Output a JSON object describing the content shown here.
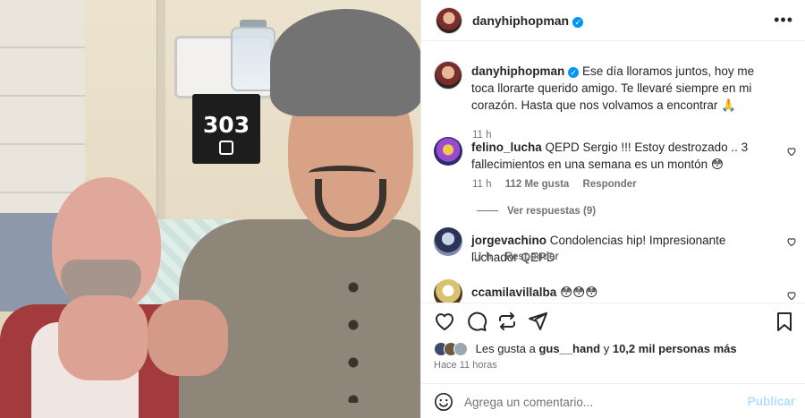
{
  "photo": {
    "room_number": "303"
  },
  "post": {
    "author": "danyhiphopman",
    "caption": "Ese día lloramos juntos, hoy me toca llorarte querido amigo. Te llevaré siempre en mi corazón. Hasta que nos volvamos a encontrar 🙏",
    "caption_time": "11 h",
    "more_label": "•••"
  },
  "comments": [
    {
      "username": "felino_lucha",
      "text": "QEPD Sergio !!! Estoy destrozado .. 3 fallecimientos en una semana es un montón 😳",
      "time": "11 h",
      "likes": "112 Me gusta",
      "reply": "Responder",
      "view_replies": "Ver respuestas (9)"
    },
    {
      "username": "jorgevachino",
      "text": "Condolencias hip! Impresionante luchador QEPD",
      "time": "11 h",
      "reply": "Responder"
    },
    {
      "username": "ccamilavillalba",
      "text": "😳😳😳"
    }
  ],
  "likes": {
    "prefix": "Les gusta a",
    "user": "gus__hand",
    "connector": "y",
    "count": "10,2 mil personas más"
  },
  "time_ago": "Hace 11 horas",
  "add_comment": {
    "placeholder": "Agrega un comentario...",
    "post_label": "Publicar"
  },
  "colors": {
    "verified": "#0095f6",
    "post_disabled": "#b2dffc",
    "muted": "#737373"
  }
}
